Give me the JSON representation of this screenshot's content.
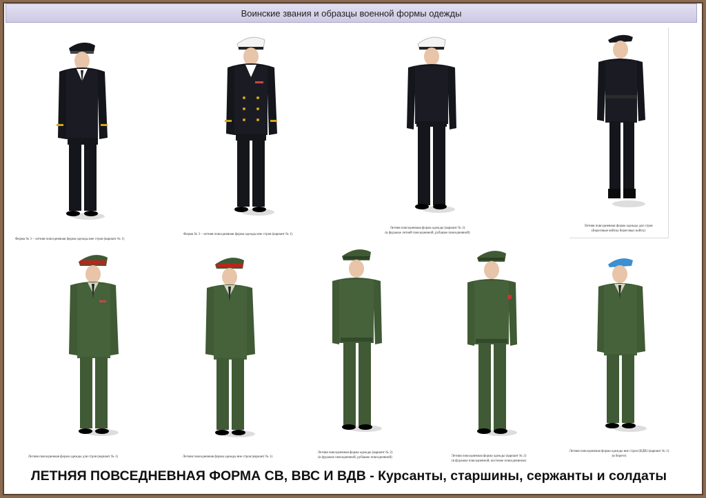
{
  "header": {
    "title": "Воинские звания и образцы военной формы одежды"
  },
  "footer": {
    "title": "ЛЕТНЯЯ  ПОВСЕДНЕВНАЯ ФОРМА СВ, ВВС  И ВДВ - Курсанты, старшины, сержанты и солдаты"
  },
  "captions": {
    "c1": "Форма № 3 – летняя повседневная форма одежды вне строя (вариант № 1)",
    "c2": "Форма № 3 – летняя повседневная форма одежды вне строя (вариант № 1)",
    "c3a": "Летняя повседневная форма одежды (вариант № 2)",
    "c3b": "(в фуражке летней повседневной, рубашке повседневной)",
    "c4a": "Летняя повседневная форма одежды для строя",
    "c4b": "(Береговые войска береговых войск)",
    "c5": "Летняя повседневная форма одежды для строя (вариант № 1)",
    "c6": "Летняя повседневная форма одежды вне строя (вариант № 1)",
    "c7a": "Летняя повседневная форма одежды (вариант № 2)",
    "c7b": "(в фуражке повседневной, рубашке повседневной)",
    "c8a": "Летняя повседневная форма одежды (вариант № 2)",
    "c8b": "(в фуражке повседневной, костюме повседневном)",
    "c9a": "Летняя повседневная форма одежды вне строя (ВДВ) (вариант № 1)",
    "c9b": "(в берете)"
  },
  "colors": {
    "navy": "#15161c",
    "green": "#3f5a34",
    "gold": "#d4a51c",
    "red": "#b8261c",
    "beret": "#3c8fd0"
  }
}
